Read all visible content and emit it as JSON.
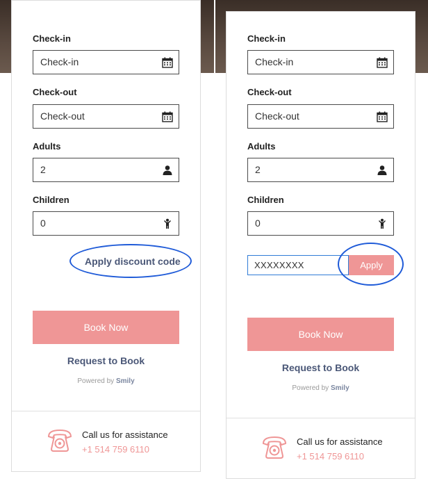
{
  "colors": {
    "accent": "#ef9696",
    "link": "#4a5777",
    "annotation": "#1f5bd8",
    "border": "#4a4a4a"
  },
  "left_panel": {
    "checkin_label": "Check-in",
    "checkin_value": "Check-in",
    "checkout_label": "Check-out",
    "checkout_value": "Check-out",
    "adults_label": "Adults",
    "adults_value": "2",
    "children_label": "Children",
    "children_value": "0",
    "discount_link": "Apply discount code",
    "book_button": "Book Now",
    "request_link": "Request to Book",
    "powered_prefix": "Powered by",
    "powered_brand": "Smily",
    "assist_title": "Call us for assistance",
    "assist_phone": "+1 514 759 6110"
  },
  "right_panel": {
    "checkin_label": "Check-in",
    "checkin_value": "Check-in",
    "checkout_label": "Check-out",
    "checkout_value": "Check-out",
    "adults_label": "Adults",
    "adults_value": "2",
    "children_label": "Children",
    "children_value": "0",
    "discount_code_value": "XXXXXXXX",
    "apply_button": "Apply",
    "book_button": "Book Now",
    "request_link": "Request to Book",
    "powered_prefix": "Powered by",
    "powered_brand": "Smily",
    "assist_title": "Call us for assistance",
    "assist_phone": "+1 514 759 6110"
  },
  "icons": {
    "checkin": "calendar-icon",
    "checkout": "calendar-icon",
    "adults": "person-icon",
    "children": "child-icon",
    "assist": "telephone-icon"
  }
}
